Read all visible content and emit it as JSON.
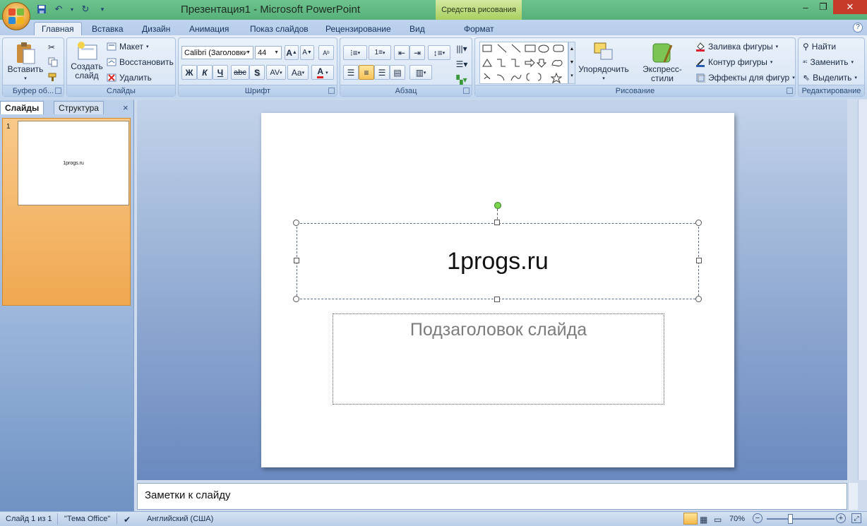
{
  "window": {
    "title": "Презентация1 - Microsoft PowerPoint",
    "context_tab_group": "Средства рисования",
    "controls": {
      "minimize": "–",
      "maximize": "❐",
      "close": "✕"
    }
  },
  "quick_access": {
    "save_icon": "save-icon",
    "undo_icon": "undo-icon",
    "redo_icon": "redo-icon",
    "customize": "▾"
  },
  "tabs": [
    "Главная",
    "Вставка",
    "Дизайн",
    "Анимация",
    "Показ слайдов",
    "Рецензирование",
    "Вид",
    "Формат"
  ],
  "active_tab": "Главная",
  "ribbon": {
    "clipboard": {
      "paste": "Вставить",
      "group": "Буфер об..."
    },
    "slides": {
      "create": "Создать слайд",
      "layout": "Макет",
      "reset": "Восстановить",
      "delete": "Удалить",
      "group": "Слайды"
    },
    "font": {
      "name": "Calibri (Заголовки)",
      "size": "44",
      "group": "Шрифт",
      "bold": "Ж",
      "italic": "К",
      "underline": "Ч",
      "strike": "abc",
      "shadow": "S",
      "spacing": "AV",
      "case": "Aa",
      "color": "A"
    },
    "paragraph": {
      "group": "Абзац"
    },
    "drawing": {
      "arrange": "Упорядочить",
      "quick_styles": "Экспресс-стили",
      "fill": "Заливка фигуры",
      "outline": "Контур фигуры",
      "effects": "Эффекты для фигур",
      "group": "Рисование"
    },
    "editing": {
      "find": "Найти",
      "replace": "Заменить",
      "select": "Выделить",
      "group": "Редактирование"
    }
  },
  "left_pane": {
    "tab_slides": "Слайды",
    "tab_outline": "Структура",
    "close": "×",
    "slide_number": "1",
    "thumb_text": "1progs.ru"
  },
  "slide": {
    "title": "1progs.ru",
    "subtitle_placeholder": "Подзаголовок слайда"
  },
  "notes": {
    "placeholder": "Заметки к слайду"
  },
  "status": {
    "slide": "Слайд 1 из 1",
    "theme": "\"Тема Office\"",
    "language": "Английский (США)",
    "zoom": "70%",
    "zoom_level": 0.7
  }
}
